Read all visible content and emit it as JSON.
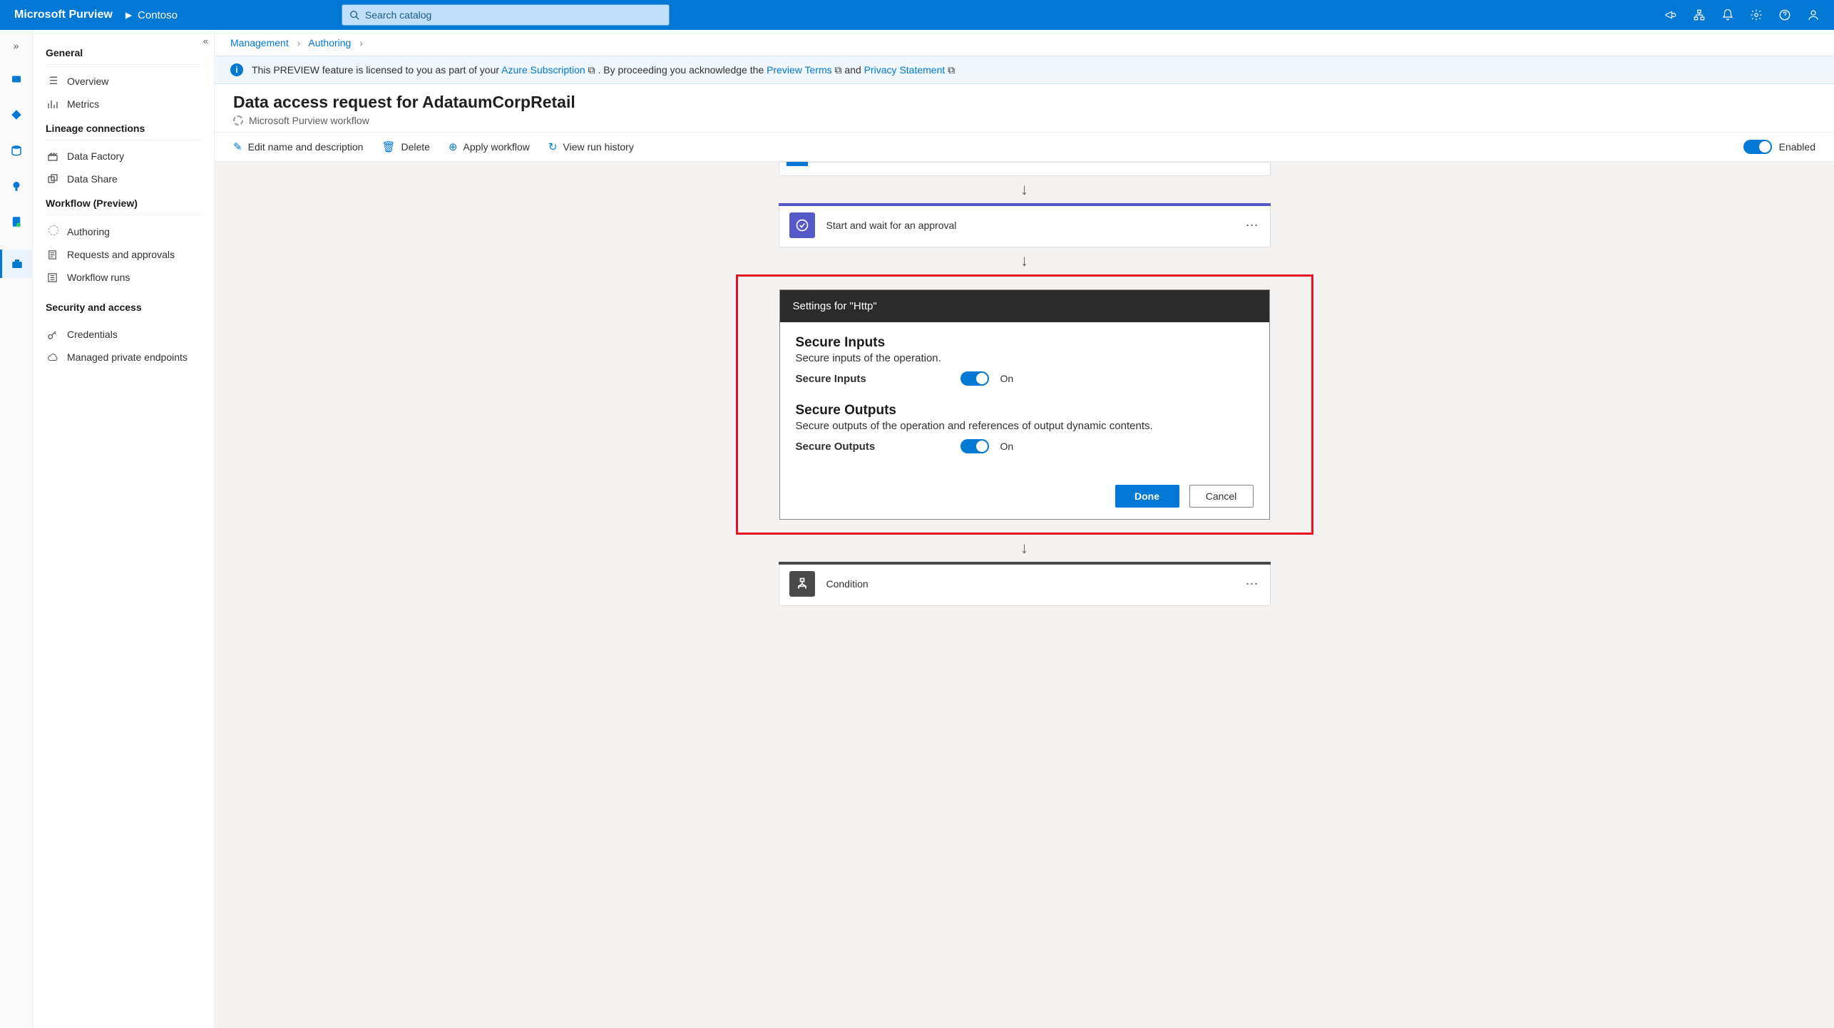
{
  "topbar": {
    "brand": "Microsoft Purview",
    "tenant": "Contoso",
    "search_placeholder": "Search catalog"
  },
  "sidenav": {
    "sections": {
      "general": {
        "title": "General",
        "overview": "Overview",
        "metrics": "Metrics"
      },
      "lineage": {
        "title": "Lineage connections",
        "datafactory": "Data Factory",
        "datashare": "Data Share"
      },
      "workflow": {
        "title": "Workflow (Preview)",
        "authoring": "Authoring",
        "requests": "Requests and approvals",
        "runs": "Workflow runs"
      },
      "security": {
        "title": "Security and access",
        "credentials": "Credentials",
        "endpoints": "Managed private endpoints"
      }
    }
  },
  "breadcrumbs": {
    "management": "Management",
    "authoring": "Authoring"
  },
  "infobar": {
    "prefix": "This PREVIEW feature is licensed to you as part of your ",
    "sub_link": "Azure Subscription",
    "middle": " . By proceeding you acknowledge the ",
    "terms_link": "Preview Terms",
    "and": " and ",
    "privacy_link": "Privacy Statement"
  },
  "page": {
    "title": "Data access request for AdataumCorpRetail",
    "subtitle": "Microsoft Purview workflow"
  },
  "commands": {
    "edit": "Edit name and description",
    "delete": "Delete",
    "apply": "Apply workflow",
    "history": "View run history",
    "enabled_label": "Enabled"
  },
  "flow": {
    "step_approval": "Start and wait for an approval",
    "step_condition": "Condition"
  },
  "settings": {
    "header": "Settings for \"Http\"",
    "secure_inputs_title": "Secure Inputs",
    "secure_inputs_desc": "Secure inputs of the operation.",
    "secure_inputs_label": "Secure Inputs",
    "secure_inputs_state": "On",
    "secure_outputs_title": "Secure Outputs",
    "secure_outputs_desc": "Secure outputs of the operation and references of output dynamic contents.",
    "secure_outputs_label": "Secure Outputs",
    "secure_outputs_state": "On",
    "done": "Done",
    "cancel": "Cancel"
  }
}
